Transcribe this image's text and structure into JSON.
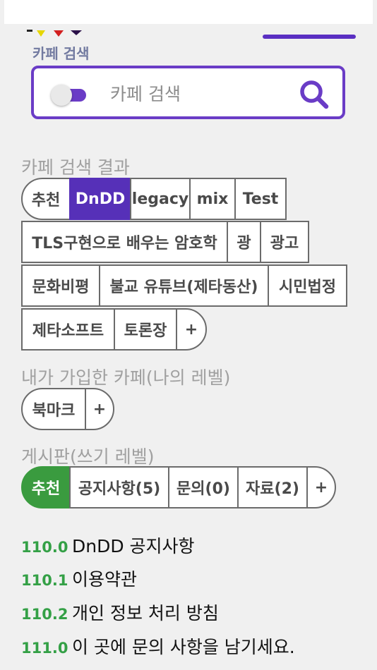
{
  "header": {
    "section_title": "카페 검색",
    "accent_color": "#5a2fc2"
  },
  "search": {
    "placeholder": "카페 검색",
    "value": ""
  },
  "results": {
    "label": "카페 검색 결과",
    "chips": [
      "추천",
      "DnDD",
      "legacy",
      "mix",
      "Test",
      "TLS구현으로 배우는 암호학",
      "광",
      "광고",
      "문화비평",
      "불교 유튜브(제타동산)",
      "시민법정",
      "제타소프트",
      "토론장"
    ],
    "selected": "DnDD",
    "add_label": "+"
  },
  "my_cafes": {
    "label": "내가 가입한 카페(나의 레벨)",
    "chips": [
      "북마크"
    ],
    "add_label": "+"
  },
  "boards": {
    "label": "게시판(쓰기 레벨)",
    "chips": [
      "추천",
      "공지사항(5)",
      "문의(0)",
      "자료(2)"
    ],
    "selected": "추천",
    "add_label": "+"
  },
  "notices": [
    {
      "num": "110.0",
      "text": "DnDD 공지사항"
    },
    {
      "num": "110.1",
      "text": "이용약관"
    },
    {
      "num": "110.2",
      "text": "개인 정보 처리 방침"
    },
    {
      "num": "111.0",
      "text": "이 곳에 문의 사항을 남기세요."
    }
  ],
  "colors": {
    "selected_purple": "#5630b8",
    "selected_green": "#3a9b3f",
    "notice_number": "#34a046"
  }
}
